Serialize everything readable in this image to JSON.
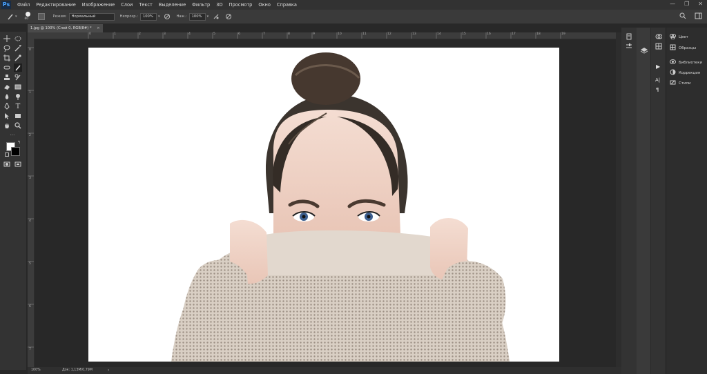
{
  "app": {
    "logo": "Ps"
  },
  "menu": [
    "Файл",
    "Редактирование",
    "Изображение",
    "Слои",
    "Текст",
    "Выделение",
    "Фильтр",
    "3D",
    "Просмотр",
    "Окно",
    "Справка"
  ],
  "options": {
    "brush_size": "60",
    "mode_label": "Режим:",
    "mode_value": "Нормальный",
    "opacity_label": "Непрозр.:",
    "opacity_value": "100%",
    "pressure_label": "Наж.:",
    "pressure_value": "100%"
  },
  "document": {
    "tab_label": "1.jpg @ 100% (Слой 0, RGB/8#) *",
    "zoom": "100%",
    "doc_info": "Док: 1,13M/0,79M"
  },
  "ruler": {
    "top": [
      "0",
      "1",
      "2",
      "3",
      "4",
      "5",
      "6",
      "7",
      "8",
      "9",
      "10",
      "11",
      "12",
      "13",
      "14",
      "15",
      "16",
      "17",
      "18",
      "19"
    ],
    "left": [
      "0",
      "1",
      "2",
      "3",
      "4",
      "5",
      "6",
      "7"
    ]
  },
  "panels": {
    "items": [
      "Цвет",
      "Образцы",
      "Библиотеки",
      "Коррекция",
      "Стили"
    ]
  },
  "icons": [
    "brush-icon",
    "move-icon",
    "lasso-icon",
    "crop-icon",
    "eyedropper-icon",
    "stamp-icon",
    "eraser-icon",
    "pen-icon",
    "text-icon",
    "hand-icon",
    "zoom-icon",
    "search-icon",
    "layers-icon",
    "play-icon"
  ],
  "colors": {
    "accent": "#4aa3ff",
    "bg": "#282828",
    "panel": "#333333"
  }
}
